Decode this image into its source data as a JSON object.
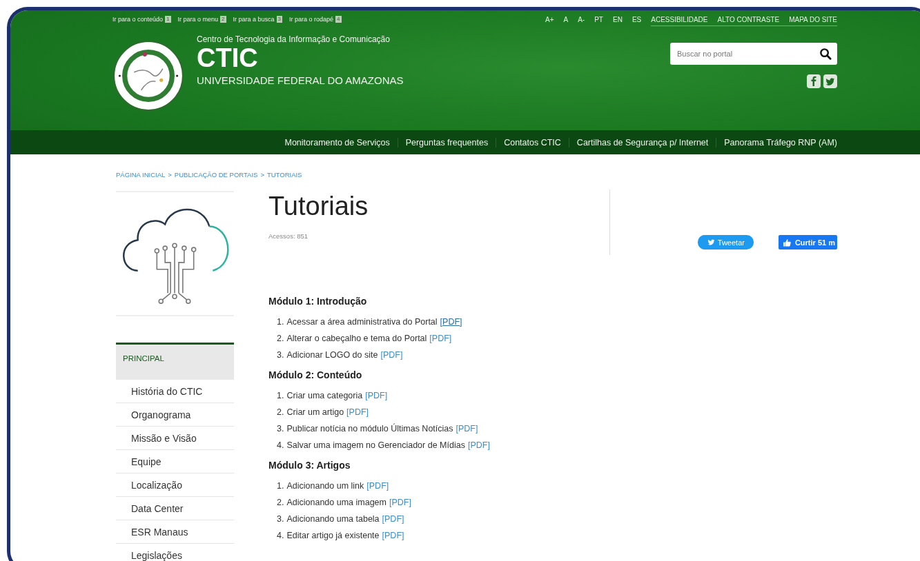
{
  "skip_links": [
    {
      "label": "Ir para o conteúdo",
      "key": "1"
    },
    {
      "label": "Ir para o menu",
      "key": "2"
    },
    {
      "label": "Ir para a busca",
      "key": "3"
    },
    {
      "label": "Ir para o rodapé",
      "key": "4"
    }
  ],
  "font_links": [
    "A+",
    "A",
    "A-"
  ],
  "language_links": [
    "PT",
    "EN",
    "ES"
  ],
  "top_links": [
    "ACESSIBILIDADE",
    "ALTO CONTRASTE",
    "MAPA DO SITE"
  ],
  "site": {
    "subtitle": "Centro de Tecnologia da Informação e Comunicação",
    "title": "CTIC",
    "university": "UNIVERSIDADE FEDERAL DO AMAZONAS"
  },
  "search": {
    "placeholder": "Buscar no portal"
  },
  "nav": [
    "Monitoramento de Serviços",
    "Perguntas frequentes",
    "Contatos CTIC",
    "Cartilhas de Segurança p/ Internet",
    "Panorama Tráfego RNP (AM)"
  ],
  "breadcrumb": {
    "separator": ">",
    "items": [
      "PÁGINA INICIAL",
      "PUBLICAÇÃO DE PORTAIS",
      "TUTORIAIS"
    ]
  },
  "sidebar": {
    "heading": "PRINCIPAL",
    "items": [
      "História do CTIC",
      "Organograma",
      "Missão e Visão",
      "Equipe",
      "Localização",
      "Data Center",
      "ESR Manaus",
      "Legislações"
    ]
  },
  "article": {
    "title": "Tutoriais",
    "hits": "Acessos: 851",
    "tweet": "Tweetar",
    "like": "Curtir 51 m",
    "modules": [
      {
        "title": "Módulo 1: Introdução",
        "items": [
          {
            "number": "1.",
            "text": "Acessar a área administrativa do Portal",
            "link": "[PDF]",
            "hovered": true
          },
          {
            "number": "2.",
            "text": "Alterar o cabeçalho e tema do Portal",
            "link": "[PDF]",
            "hovered": false
          },
          {
            "number": "3.",
            "text": "Adicionar LOGO do site",
            "link": "[PDF]",
            "hovered": false
          }
        ]
      },
      {
        "title": "Módulo 2: Conteúdo",
        "items": [
          {
            "number": "1.",
            "text": "Criar uma categoria",
            "link": "[PDF]",
            "hovered": false
          },
          {
            "number": "2.",
            "text": "Criar um artigo",
            "link": "[PDF]",
            "hovered": false
          },
          {
            "number": "3.",
            "text": "Publicar notícia no módulo Últimas Notícias",
            "link": "[PDF]",
            "hovered": false
          },
          {
            "number": "4.",
            "text": "Salvar uma imagem no Gerenciador de Mídias",
            "link": "[PDF]",
            "hovered": false
          }
        ]
      },
      {
        "title": "Módulo 3: Artigos",
        "items": [
          {
            "number": "1.",
            "text": "Adicionando um link",
            "link": "[PDF]",
            "hovered": false
          },
          {
            "number": "2.",
            "text": "Adicionando uma imagem",
            "link": "[PDF]",
            "hovered": false
          },
          {
            "number": "3.",
            "text": "Adicionando uma tabela",
            "link": "[PDF]",
            "hovered": false
          },
          {
            "number": "4.",
            "text": "Editar artigo já existente",
            "link": "[PDF]",
            "hovered": false
          }
        ]
      }
    ]
  }
}
